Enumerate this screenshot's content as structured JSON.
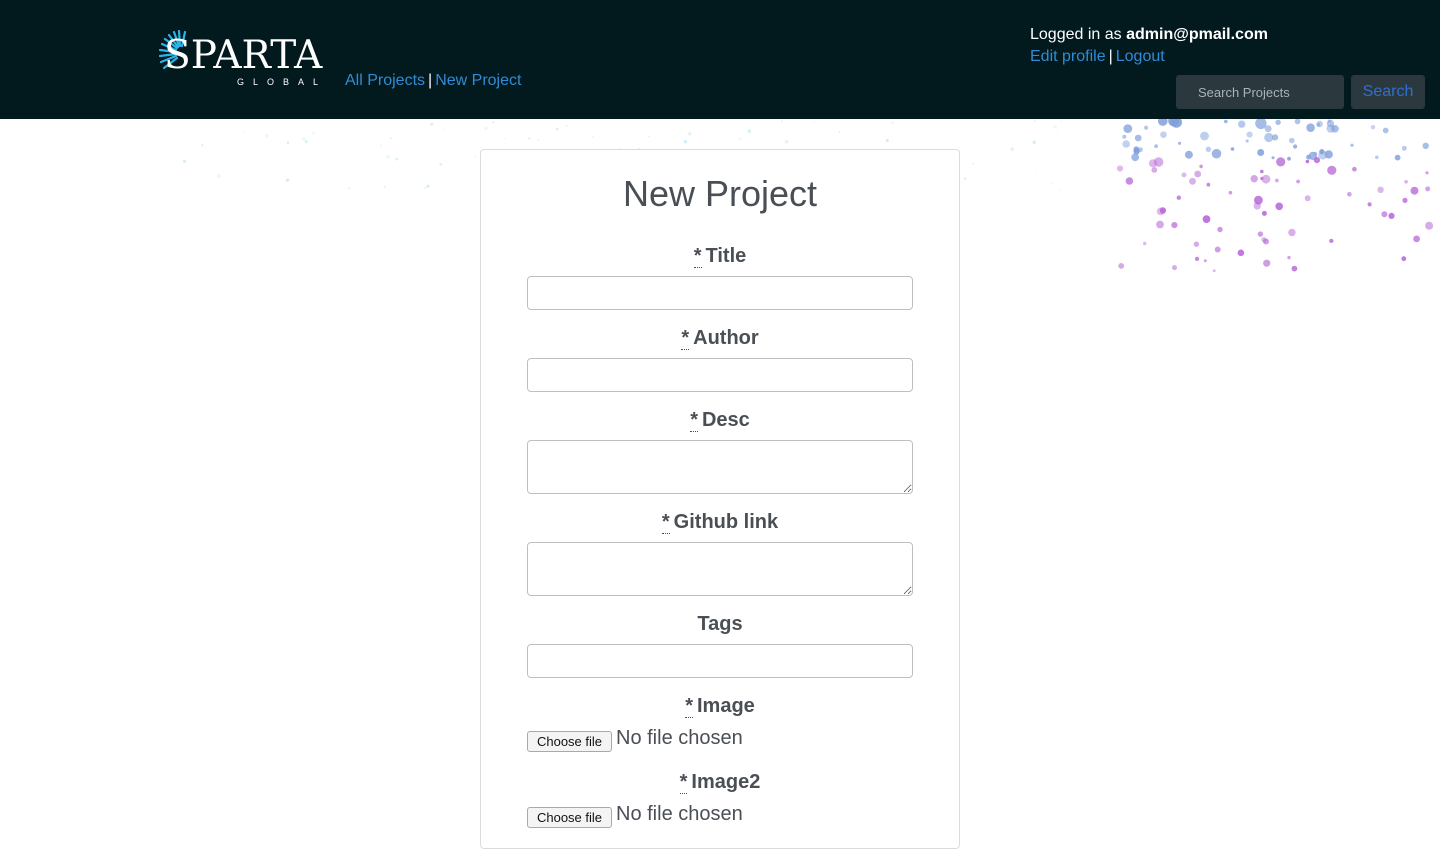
{
  "header": {
    "logo_text": "SPARTA",
    "logo_subtext": "GLOBAL",
    "nav": {
      "all_projects": "All Projects",
      "separator": "|",
      "new_project": "New Project"
    },
    "user": {
      "logged_in_prefix": "Logged in as",
      "email": "admin@pmail.com",
      "edit_profile": "Edit profile",
      "separator": "|",
      "logout": "Logout"
    },
    "search": {
      "placeholder": "Search Projects",
      "button_label": "Search"
    }
  },
  "form": {
    "title": "New Project",
    "required_marker": "*",
    "fields": [
      {
        "label": "Title",
        "required": true,
        "type": "text"
      },
      {
        "label": "Author",
        "required": true,
        "type": "text"
      },
      {
        "label": "Desc",
        "required": true,
        "type": "textarea"
      },
      {
        "label": "Github link",
        "required": true,
        "type": "textarea"
      },
      {
        "label": "Tags",
        "required": false,
        "type": "text"
      },
      {
        "label": "Image",
        "required": true,
        "type": "file"
      },
      {
        "label": "Image2",
        "required": true,
        "type": "file"
      }
    ],
    "file_button_label": "Choose file",
    "file_status": "No file chosen"
  },
  "colors": {
    "navbar_bg": "#02191e",
    "link": "#2f8cd6",
    "heading_text": "#4a4f55",
    "dot_blue": "#7f9fdc",
    "dot_purple": "#b666d6"
  }
}
